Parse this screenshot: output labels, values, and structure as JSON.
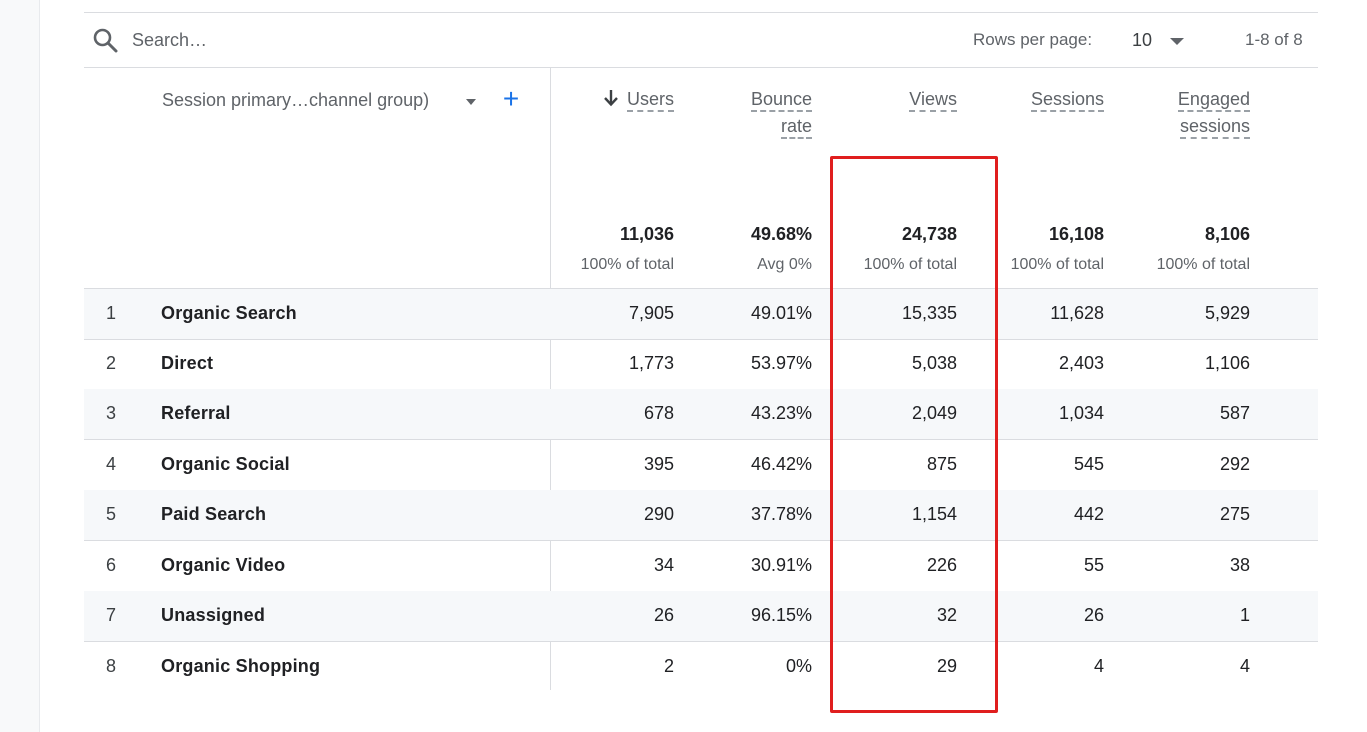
{
  "search": {
    "placeholder": "Search…"
  },
  "pagination": {
    "rows_label": "Rows per page:",
    "rows_value": "10",
    "range": "1-8 of 8"
  },
  "dimension": {
    "header": "Session primary…channel group)",
    "add_label": "+"
  },
  "columns": [
    {
      "id": "users",
      "label_lines": [
        "Users"
      ],
      "sorted": true,
      "total": "11,036",
      "total_sub": "100% of total"
    },
    {
      "id": "bounce",
      "label_lines": [
        "Bounce",
        "rate"
      ],
      "sorted": false,
      "total": "49.68%",
      "total_sub": "Avg 0%"
    },
    {
      "id": "views",
      "label_lines": [
        "Views"
      ],
      "sorted": false,
      "total": "24,738",
      "total_sub": "100% of total"
    },
    {
      "id": "sessions",
      "label_lines": [
        "Sessions"
      ],
      "sorted": false,
      "total": "16,108",
      "total_sub": "100% of total"
    },
    {
      "id": "engaged",
      "label_lines": [
        "Engaged",
        "sessions"
      ],
      "sorted": false,
      "total": "8,106",
      "total_sub": "100% of total"
    }
  ],
  "rows": [
    {
      "index": "1",
      "channel": "Organic Search",
      "users": "7,905",
      "bounce": "49.01%",
      "views": "15,335",
      "sessions": "11,628",
      "engaged": "5,929"
    },
    {
      "index": "2",
      "channel": "Direct",
      "users": "1,773",
      "bounce": "53.97%",
      "views": "5,038",
      "sessions": "2,403",
      "engaged": "1,106"
    },
    {
      "index": "3",
      "channel": "Referral",
      "users": "678",
      "bounce": "43.23%",
      "views": "2,049",
      "sessions": "1,034",
      "engaged": "587"
    },
    {
      "index": "4",
      "channel": "Organic Social",
      "users": "395",
      "bounce": "46.42%",
      "views": "875",
      "sessions": "545",
      "engaged": "292"
    },
    {
      "index": "5",
      "channel": "Paid Search",
      "users": "290",
      "bounce": "37.78%",
      "views": "1,154",
      "sessions": "442",
      "engaged": "275"
    },
    {
      "index": "6",
      "channel": "Organic Video",
      "users": "34",
      "bounce": "30.91%",
      "views": "226",
      "sessions": "55",
      "engaged": "38"
    },
    {
      "index": "7",
      "channel": "Unassigned",
      "users": "26",
      "bounce": "96.15%",
      "views": "32",
      "sessions": "26",
      "engaged": "1"
    },
    {
      "index": "8",
      "channel": "Organic Shopping",
      "users": "2",
      "bounce": "0%",
      "views": "29",
      "sessions": "4",
      "engaged": "4"
    }
  ],
  "icons": {
    "search": "search-icon",
    "sort": "arrow-down-icon",
    "dropdown": "caret-down-icon",
    "add": "plus-icon"
  },
  "colors": {
    "highlight": "#e01e1e",
    "accent": "#1a73e8",
    "row_shade": "#f6f8fa"
  }
}
